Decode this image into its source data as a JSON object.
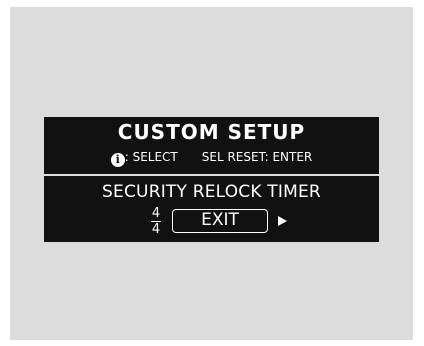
{
  "screen": {
    "title": "CUSTOM SETUP",
    "hints": {
      "info_icon": "info-icon",
      "select_label": ": SELECT",
      "reset_label": "SEL RESET: ENTER"
    },
    "item_label": "SECURITY RELOCK TIMER",
    "page": {
      "current": "4",
      "total": "4"
    },
    "exit_label": "EXIT",
    "next_icon": "right-arrow-icon"
  },
  "colors": {
    "background": "#dcdcdc",
    "display": "#111111",
    "text": "#ffffff"
  }
}
